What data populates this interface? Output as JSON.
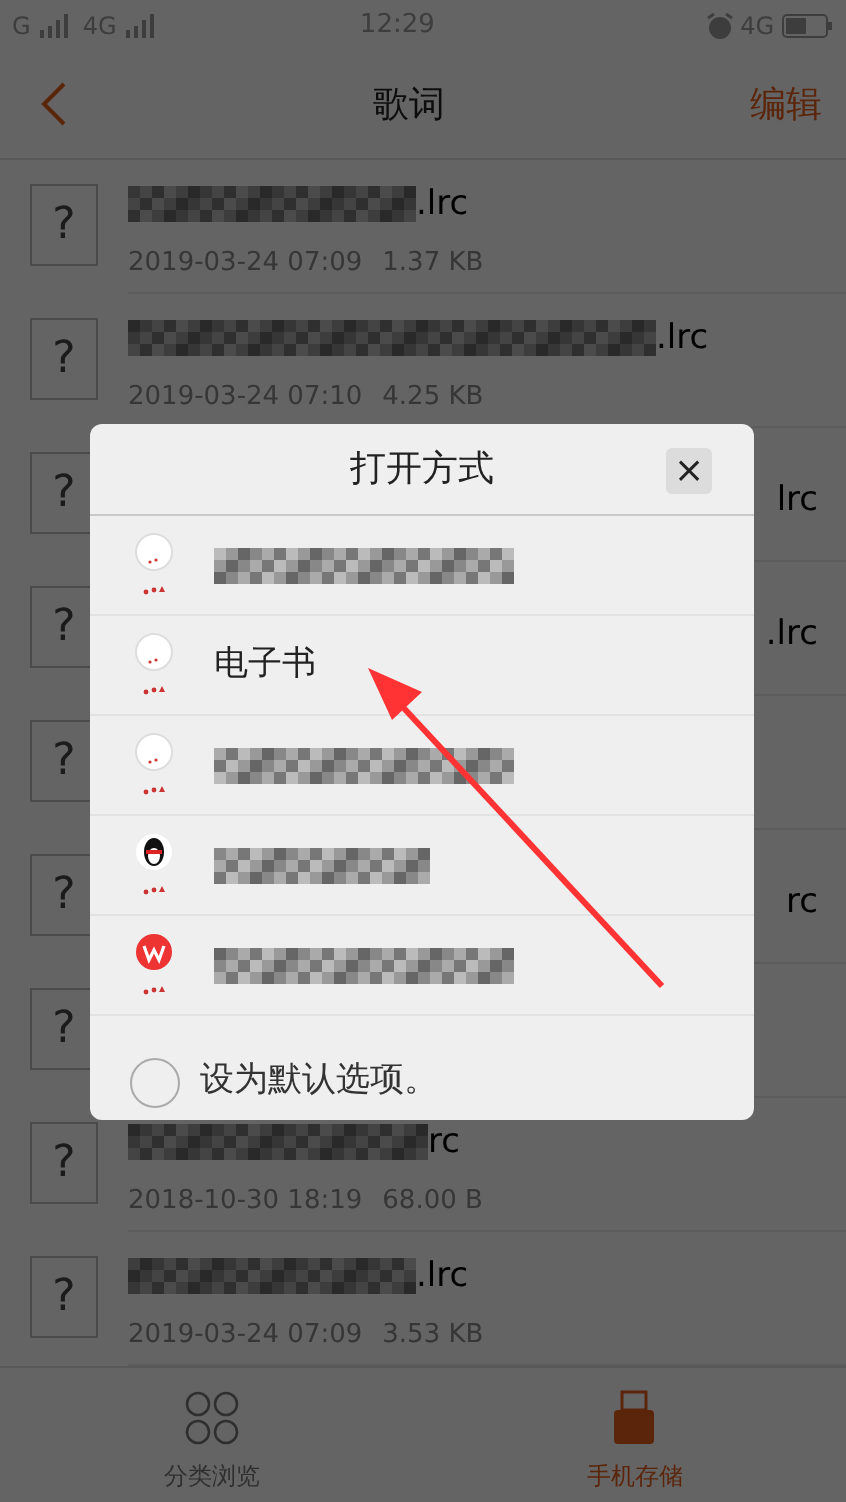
{
  "status_bar": {
    "carriers": [
      "G",
      "4G"
    ],
    "time": "12:29",
    "network": "4G"
  },
  "header": {
    "title": "歌词",
    "action": "编辑"
  },
  "files": [
    {
      "icon_text": "?",
      "name": ".lrc",
      "name_blurred": true,
      "covered": false,
      "date": "2019-03-24 07:09",
      "size": "1.37 KB"
    },
    {
      "icon_text": "?",
      "name": ".lrc",
      "name_blurred": true,
      "covered": false,
      "date": "2019-03-24 07:10",
      "size": "4.25 KB"
    },
    {
      "icon_text": "?",
      "name": "lrc",
      "name_blurred": false,
      "covered": true
    },
    {
      "icon_text": "?",
      "name": ".lrc",
      "name_blurred": false,
      "covered": true
    },
    {
      "icon_text": "?"
    },
    {
      "icon_text": "?",
      "name": "rc",
      "name_blurred": false,
      "covered": true
    },
    {
      "icon_text": "?"
    },
    {
      "icon_text": "?",
      "name": "rc",
      "name_blurred": true,
      "covered": false,
      "date": "2018-10-30 18:19",
      "size": "68.00 B"
    },
    {
      "icon_text": "?",
      "name": ".lrc",
      "name_blurred": true,
      "covered": false,
      "date": "2019-03-24 07:09",
      "size": "3.53 KB"
    }
  ],
  "dialog": {
    "title": "打开方式",
    "close": "×",
    "apps": [
      {
        "kind": "generic",
        "name_blurred": true
      },
      {
        "kind": "generic",
        "name": "电子书",
        "name_blurred": false
      },
      {
        "kind": "generic",
        "name_blurred": true
      },
      {
        "kind": "penguin",
        "name_blurred": true
      },
      {
        "kind": "office",
        "name_blurred": true
      }
    ],
    "default_option": {
      "label": "设为默认选项。",
      "checked": false
    }
  },
  "bottom_nav": [
    {
      "label": "分类浏览",
      "kind": "grid",
      "selected": false
    },
    {
      "label": "手机存储",
      "kind": "usb",
      "selected": true
    }
  ]
}
